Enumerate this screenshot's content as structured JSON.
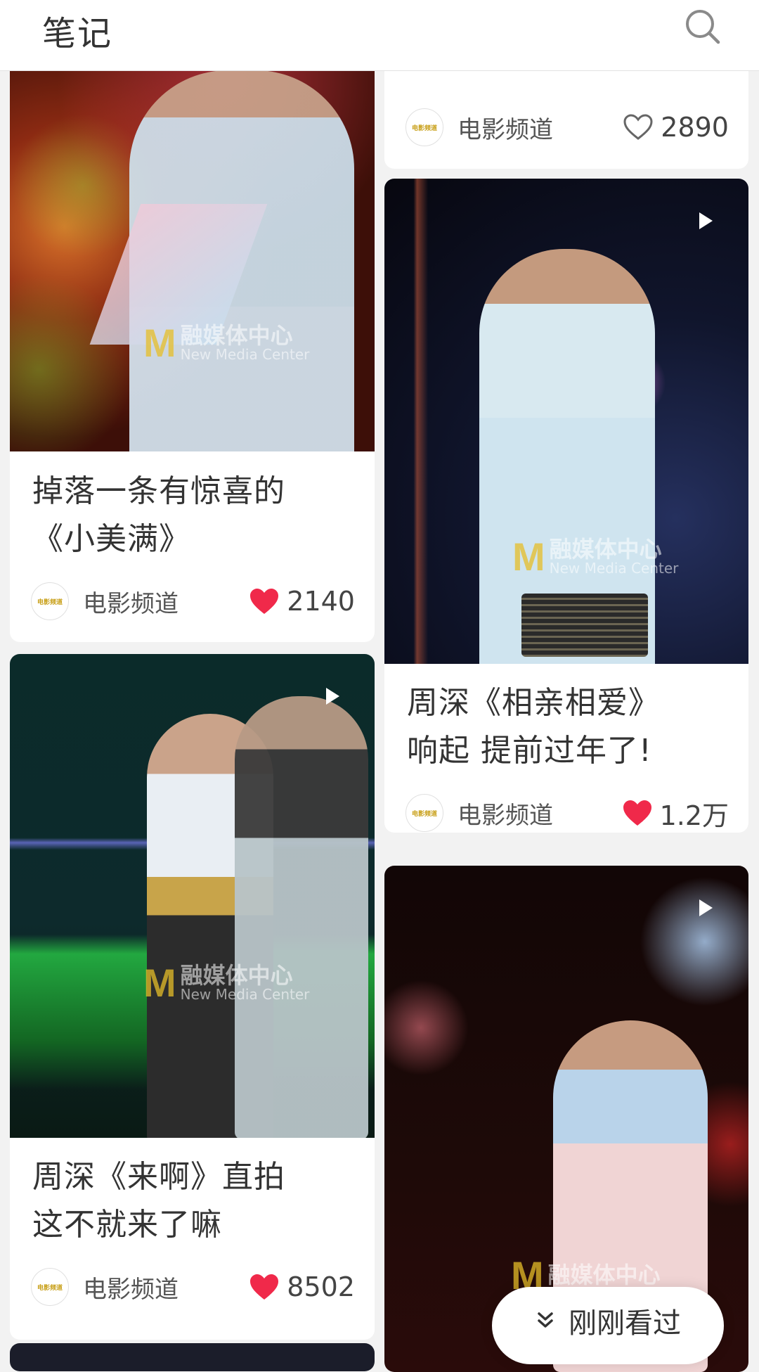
{
  "header": {
    "title": "笔记"
  },
  "cards": [
    {
      "title": "掉落一条有惊喜的\n《小美满》",
      "author": "电影频道",
      "likes": "2140",
      "liked": true
    },
    {
      "title": "周深《来啊》直拍\n这不就来了嘛",
      "author": "电影频道",
      "likes": "8502",
      "liked": true
    },
    {
      "author": "电影频道",
      "likes": "2890",
      "liked": false
    },
    {
      "title": "周深《相亲相爱》\n响起 提前过年了!",
      "author": "电影频道",
      "likes": "1.2万",
      "liked": true
    }
  ],
  "watermark": {
    "cn": "融媒体中心",
    "en": "New Media Center",
    "channel": "电影频道"
  },
  "avatar_text": "电影频道",
  "recent_button": {
    "label": "刚刚看过"
  },
  "colors": {
    "like_red": "#f0294a",
    "header_bg": "#ffffff",
    "page_bg": "#f2f2f2"
  }
}
